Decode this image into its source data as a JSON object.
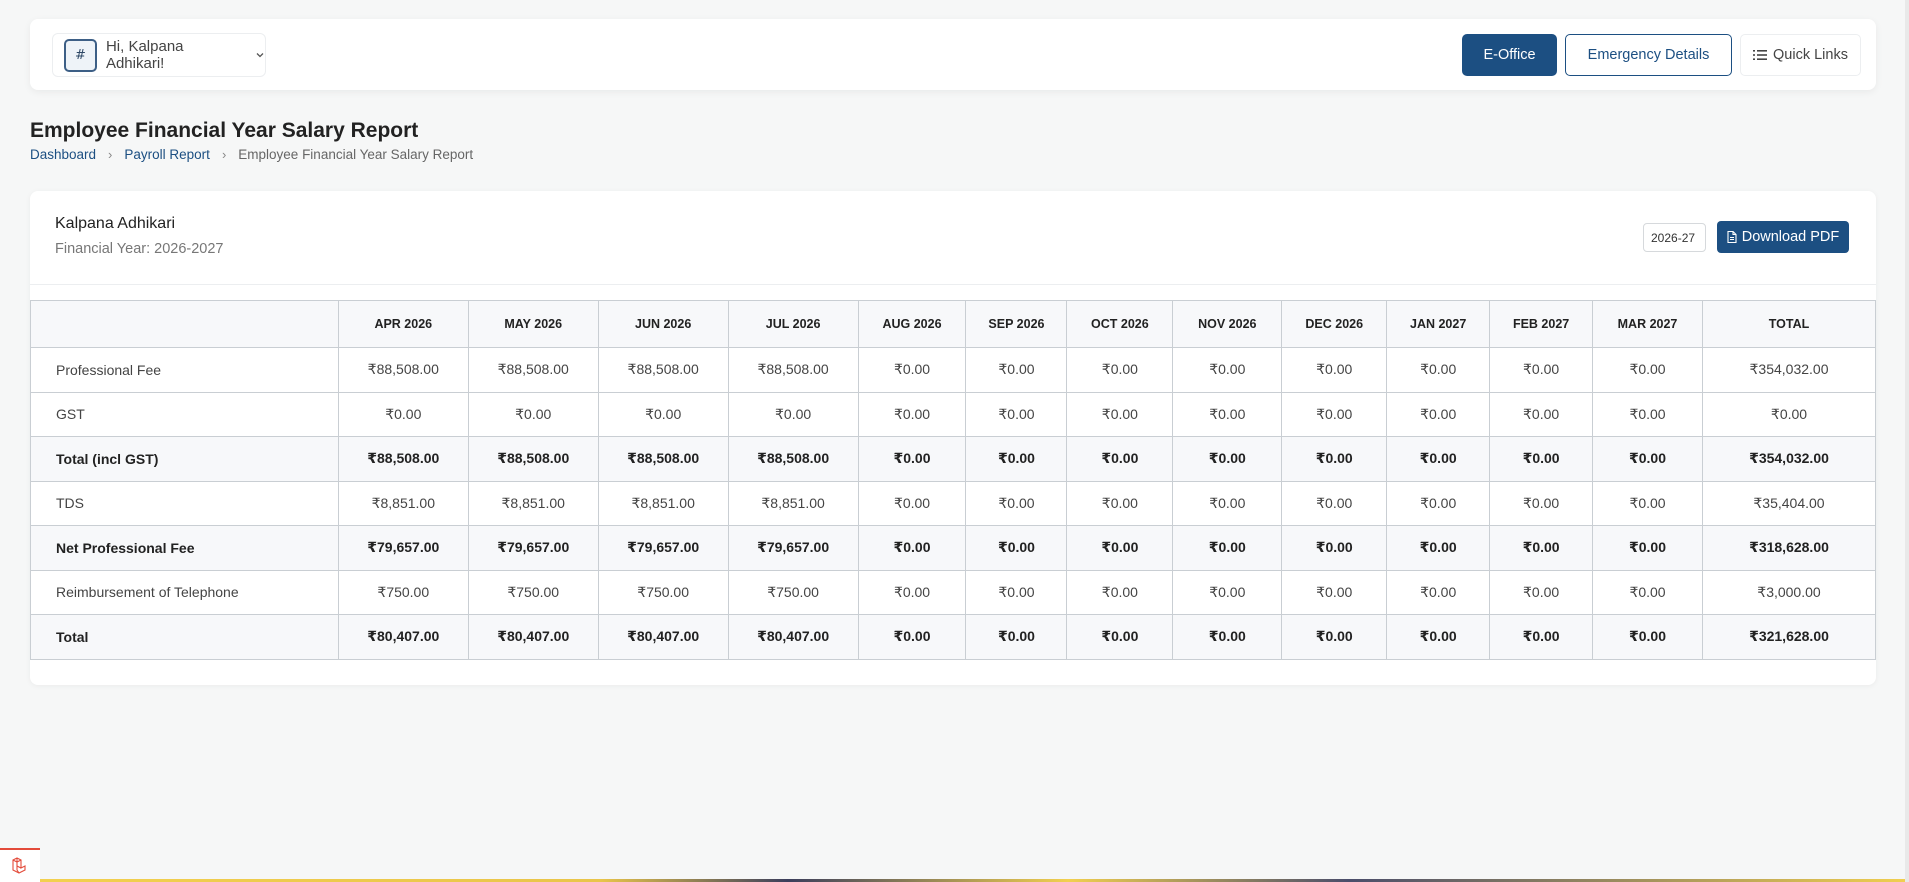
{
  "header": {
    "avatar_glyph": "#",
    "greeting": "Hi, Kalpana Adhikari!",
    "buttons": {
      "eoffice": "E-Office",
      "emergency": "Emergency Details",
      "quick_links": "Quick Links"
    }
  },
  "page": {
    "title": "Employee Financial Year Salary Report",
    "breadcrumb": [
      "Dashboard",
      "Payroll Report",
      "Employee Financial Year Salary Report"
    ]
  },
  "report": {
    "employee_name": "Kalpana Adhikari",
    "financial_year_label": "Financial Year: 2026-2027",
    "year_select_value": "2026-27",
    "download_label": "Download PDF",
    "columns": [
      "",
      "APR 2026",
      "MAY 2026",
      "JUN 2026",
      "JUL 2026",
      "AUG 2026",
      "SEP 2026",
      "OCT 2026",
      "NOV 2026",
      "DEC 2026",
      "JAN 2027",
      "FEB 2027",
      "MAR 2027",
      "TOTAL"
    ],
    "rows": [
      {
        "label": "Professional Fee",
        "bold": false,
        "values": [
          "₹88,508.00",
          "₹88,508.00",
          "₹88,508.00",
          "₹88,508.00",
          "₹0.00",
          "₹0.00",
          "₹0.00",
          "₹0.00",
          "₹0.00",
          "₹0.00",
          "₹0.00",
          "₹0.00",
          "₹354,032.00"
        ]
      },
      {
        "label": "GST",
        "bold": false,
        "values": [
          "₹0.00",
          "₹0.00",
          "₹0.00",
          "₹0.00",
          "₹0.00",
          "₹0.00",
          "₹0.00",
          "₹0.00",
          "₹0.00",
          "₹0.00",
          "₹0.00",
          "₹0.00",
          "₹0.00"
        ]
      },
      {
        "label": "Total (incl GST)",
        "bold": true,
        "values": [
          "₹88,508.00",
          "₹88,508.00",
          "₹88,508.00",
          "₹88,508.00",
          "₹0.00",
          "₹0.00",
          "₹0.00",
          "₹0.00",
          "₹0.00",
          "₹0.00",
          "₹0.00",
          "₹0.00",
          "₹354,032.00"
        ]
      },
      {
        "label": "TDS",
        "bold": false,
        "values": [
          "₹8,851.00",
          "₹8,851.00",
          "₹8,851.00",
          "₹8,851.00",
          "₹0.00",
          "₹0.00",
          "₹0.00",
          "₹0.00",
          "₹0.00",
          "₹0.00",
          "₹0.00",
          "₹0.00",
          "₹35,404.00"
        ]
      },
      {
        "label": "Net Professional Fee",
        "bold": true,
        "values": [
          "₹79,657.00",
          "₹79,657.00",
          "₹79,657.00",
          "₹79,657.00",
          "₹0.00",
          "₹0.00",
          "₹0.00",
          "₹0.00",
          "₹0.00",
          "₹0.00",
          "₹0.00",
          "₹0.00",
          "₹318,628.00"
        ]
      },
      {
        "label": "Reimbursement of Telephone",
        "bold": false,
        "values": [
          "₹750.00",
          "₹750.00",
          "₹750.00",
          "₹750.00",
          "₹0.00",
          "₹0.00",
          "₹0.00",
          "₹0.00",
          "₹0.00",
          "₹0.00",
          "₹0.00",
          "₹0.00",
          "₹3,000.00"
        ]
      },
      {
        "label": "Total",
        "bold": true,
        "values": [
          "₹80,407.00",
          "₹80,407.00",
          "₹80,407.00",
          "₹80,407.00",
          "₹0.00",
          "₹0.00",
          "₹0.00",
          "₹0.00",
          "₹0.00",
          "₹0.00",
          "₹0.00",
          "₹0.00",
          "₹321,628.00"
        ]
      }
    ]
  },
  "icons": {
    "avatar": "broken-image-icon",
    "user_menu_chevron": "chevron-down-icon",
    "quick_links": "list-icon",
    "breadcrumb_separator": "chevron-right-icon",
    "download": "file-icon",
    "corner": "laravel-logo-icon"
  },
  "colors": {
    "primary": "#1c4f82",
    "background": "#f6f7f7",
    "table_header_bg": "#f7f8fa",
    "border": "#c9ced3",
    "corner_accent": "#e34b3a"
  }
}
